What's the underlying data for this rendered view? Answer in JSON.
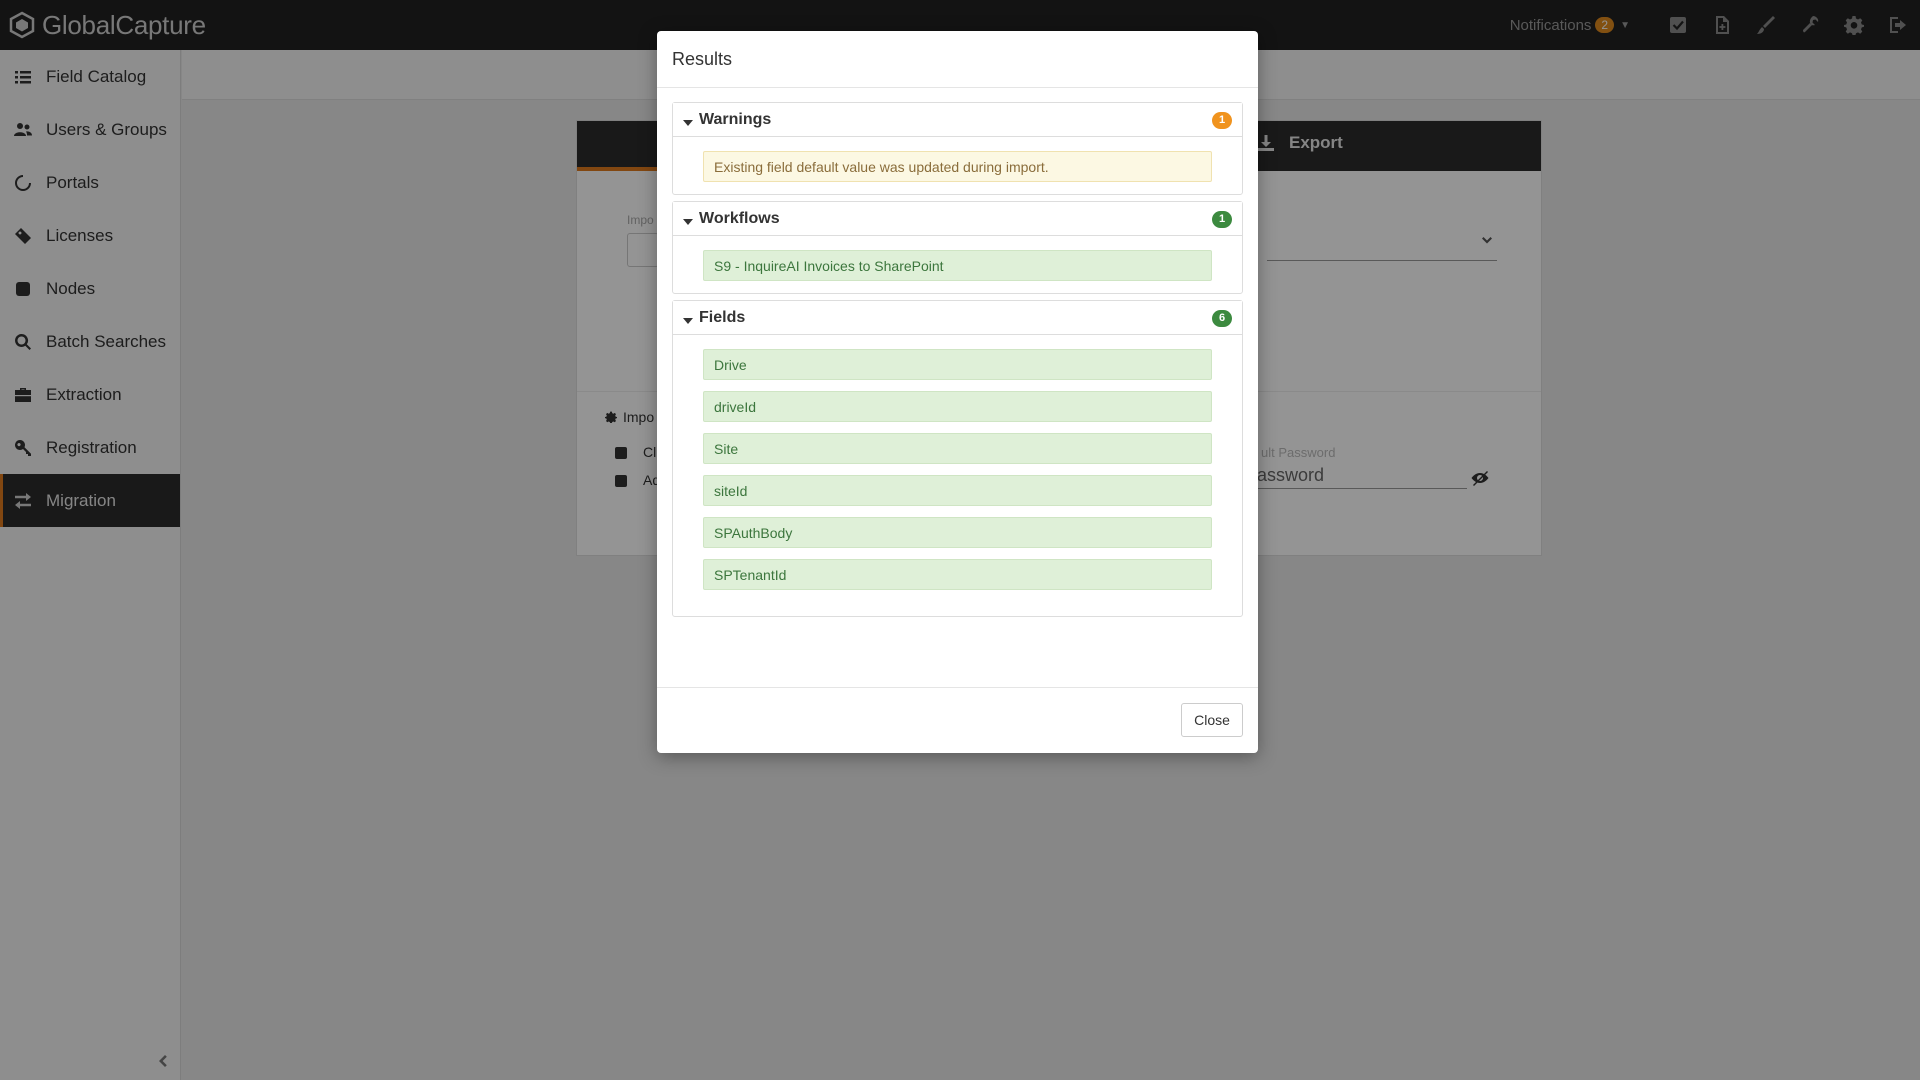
{
  "app": {
    "brand_name": "GlobalCapture",
    "accent_color": "#e07a1e"
  },
  "topbar": {
    "notifications_label": "Notifications",
    "notifications_count": "2",
    "icons": [
      "tasks-icon",
      "new-document-icon",
      "brush-icon",
      "wrench-icon",
      "gear-icon",
      "logout-icon"
    ]
  },
  "sidebar": {
    "items": [
      {
        "label": "Field Catalog",
        "icon": "list-icon"
      },
      {
        "label": "Users & Groups",
        "icon": "users-icon"
      },
      {
        "label": "Portals",
        "icon": "portal-icon"
      },
      {
        "label": "Licenses",
        "icon": "ticket-icon"
      },
      {
        "label": "Nodes",
        "icon": "node-icon"
      },
      {
        "label": "Batch Searches",
        "icon": "search-icon"
      },
      {
        "label": "Extraction",
        "icon": "briefcase-icon"
      },
      {
        "label": "Registration",
        "icon": "key-icon"
      },
      {
        "label": "Migration",
        "icon": "exchange-icon",
        "active": true
      }
    ]
  },
  "background_panel": {
    "export_label": "Export",
    "import_label_partial": "Impo",
    "options_label_partial": "Impo",
    "checkbox1_partial": "Cl",
    "checkbox2_partial": "Ad",
    "password_label_partial": "ult Password",
    "password_placeholder_partial": "assword"
  },
  "modal": {
    "title": "Results",
    "close_label": "Close",
    "warnings": {
      "title": "Warnings",
      "count": "1",
      "color": "#f0931e",
      "items": [
        "Existing field default value was updated during import."
      ]
    },
    "workflows": {
      "title": "Workflows",
      "count": "1",
      "color": "#3c8a3f",
      "items": [
        "S9 - InquireAI Invoices to SharePoint"
      ]
    },
    "fields": {
      "title": "Fields",
      "count": "6",
      "color": "#3c8a3f",
      "items": [
        "Drive",
        "driveId",
        "Site",
        "siteId",
        "SPAuthBody",
        "SPTenantId"
      ]
    }
  }
}
